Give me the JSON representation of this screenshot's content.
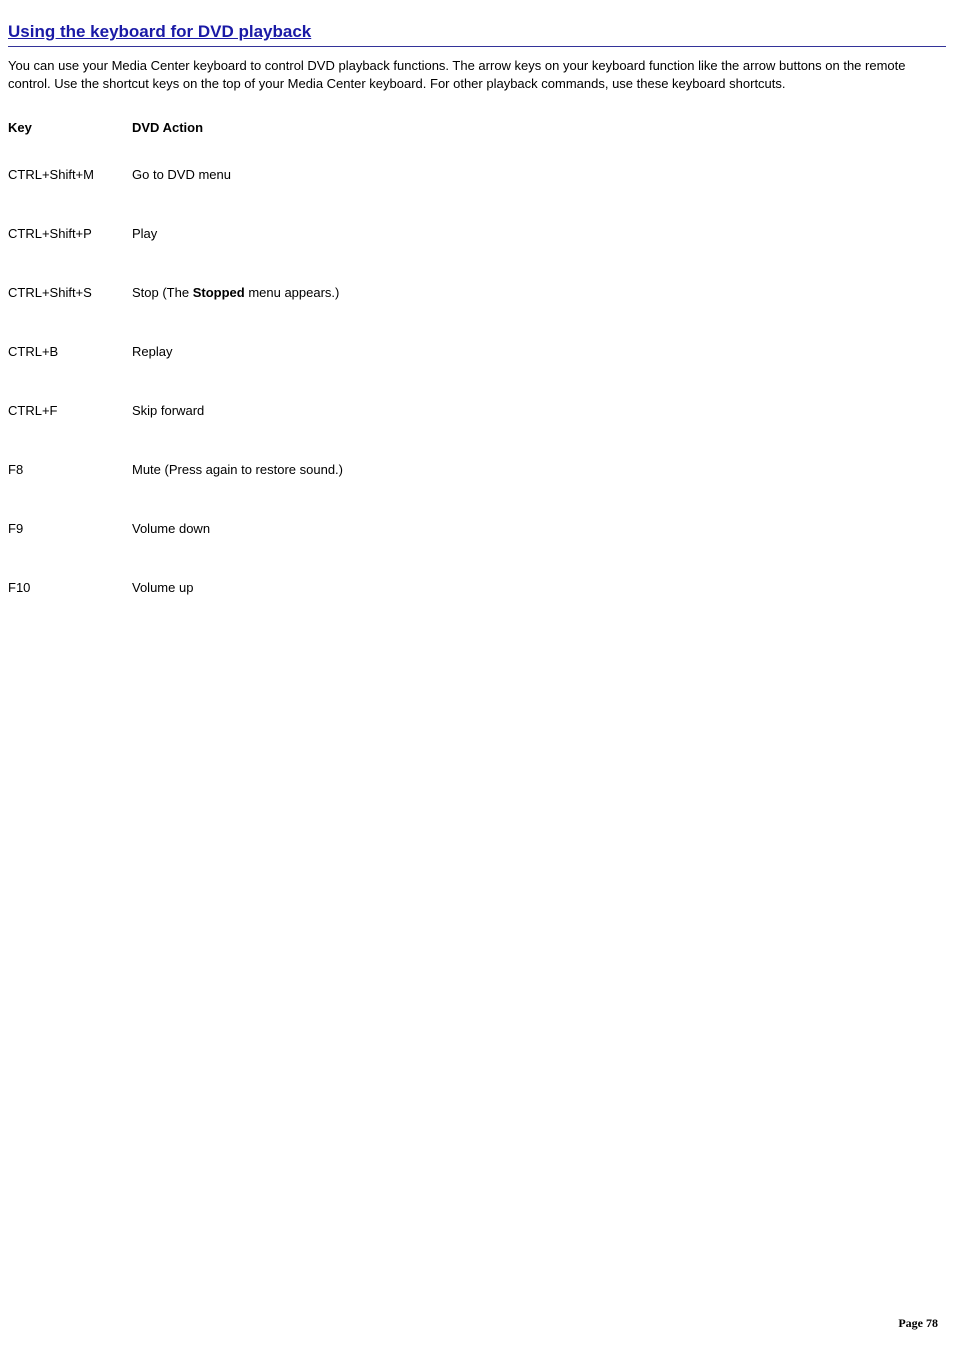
{
  "title": "Using the keyboard for DVD playback",
  "intro": "You can use your Media Center keyboard to control DVD playback functions. The arrow keys on your keyboard function like the arrow buttons on the remote control. Use the shortcut keys on the top of your Media Center keyboard. For other playback commands, use these keyboard shortcuts.",
  "headers": {
    "key": "Key",
    "action": "DVD Action"
  },
  "rows": [
    {
      "key": "CTRL+Shift+M",
      "action_pre": "Go to DVD menu",
      "action_bold": "",
      "action_post": ""
    },
    {
      "key": "CTRL+Shift+P",
      "action_pre": "Play",
      "action_bold": "",
      "action_post": ""
    },
    {
      "key": "CTRL+Shift+S",
      "action_pre": "Stop (The ",
      "action_bold": "Stopped",
      "action_post": " menu appears.)"
    },
    {
      "key": "CTRL+B",
      "action_pre": "Replay",
      "action_bold": "",
      "action_post": ""
    },
    {
      "key": "CTRL+F",
      "action_pre": "Skip forward",
      "action_bold": "",
      "action_post": ""
    },
    {
      "key": "F8",
      "action_pre": "Mute (Press again to restore sound.)",
      "action_bold": "",
      "action_post": ""
    },
    {
      "key": "F9",
      "action_pre": "Volume down",
      "action_bold": "",
      "action_post": ""
    },
    {
      "key": "F10",
      "action_pre": "Volume up",
      "action_bold": "",
      "action_post": ""
    }
  ],
  "footer": {
    "label": "Page ",
    "number": "78"
  }
}
